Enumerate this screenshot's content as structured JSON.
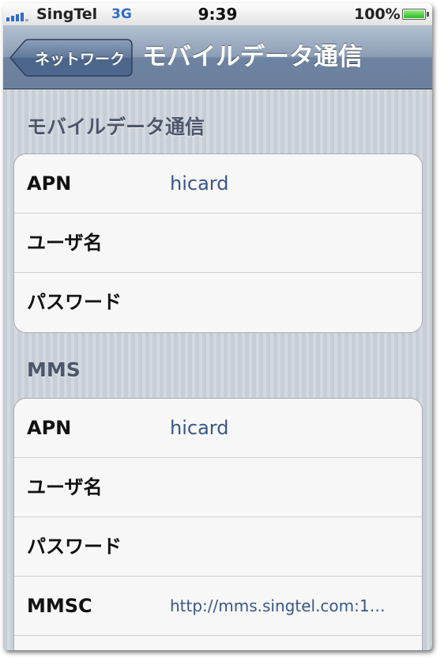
{
  "status_bar": {
    "carrier": "SingTel",
    "network": "3G",
    "time": "9:39",
    "battery_percent": "100%",
    "battery_level": 1.0,
    "signal_bars_on": 4,
    "signal_bars_total": 5
  },
  "nav": {
    "back_label": "ネットワーク",
    "title": "モバイルデータ通信"
  },
  "sections": {
    "mobile_data": {
      "header": "モバイルデータ通信",
      "rows": [
        {
          "label": "APN",
          "value": "hicard"
        },
        {
          "label": "ユーザ名",
          "value": ""
        },
        {
          "label": "パスワード",
          "value": ""
        }
      ]
    },
    "mms": {
      "header": "MMS",
      "rows": [
        {
          "label": "APN",
          "value": "hicard"
        },
        {
          "label": "ユーザ名",
          "value": ""
        },
        {
          "label": "パスワード",
          "value": ""
        },
        {
          "label": "MMSC",
          "value": "http://mms.singtel.com:1…"
        },
        {
          "label": "",
          "value": ""
        }
      ]
    }
  },
  "colors": {
    "nav_bar": "#6d83a1",
    "value_text": "#37578a",
    "section_header": "#4c566c",
    "signal": "#2f6cc8"
  }
}
